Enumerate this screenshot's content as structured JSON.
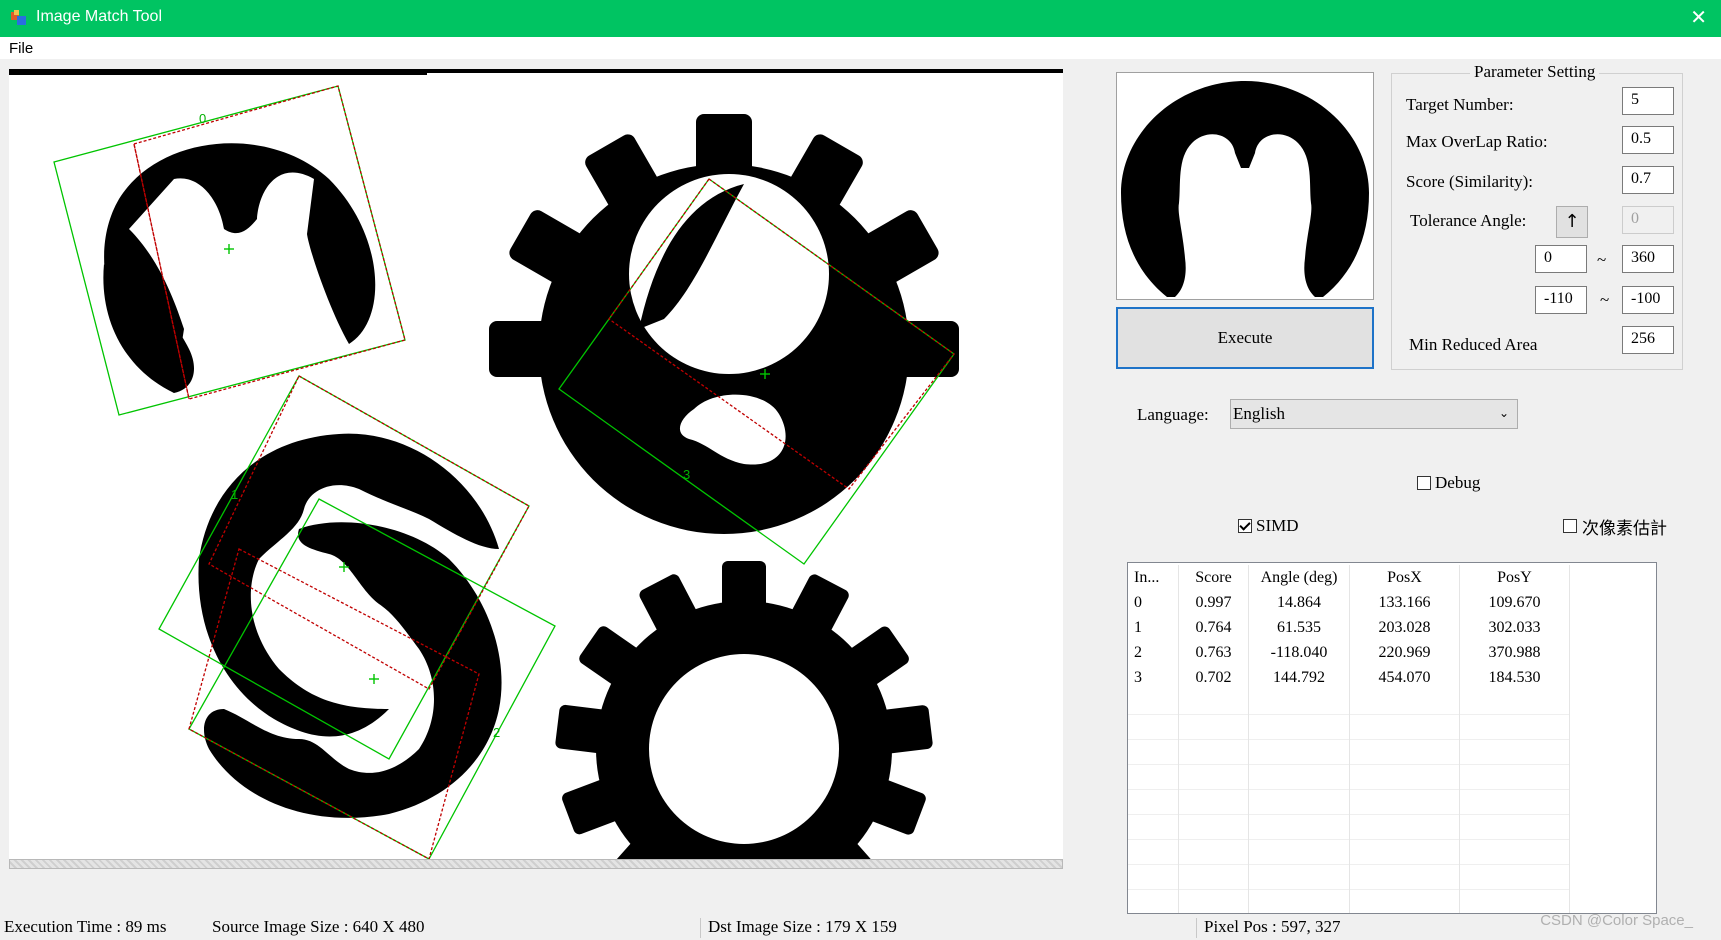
{
  "window": {
    "title": "Image Match Tool",
    "close_glyph": "✕"
  },
  "menu": {
    "file": "File"
  },
  "canvas": {
    "match_labels": [
      "0",
      "1",
      "2",
      "3"
    ],
    "accent_color": "#00c400",
    "dash_color": "#c00000"
  },
  "execute_label": "Execute",
  "params": {
    "legend": "Parameter Setting",
    "target_number": {
      "label": "Target Number:",
      "value": "5"
    },
    "max_overlap": {
      "label": "Max OverLap Ratio:",
      "value": "0.5"
    },
    "score": {
      "label": "Score (Similarity):",
      "value": "0.7"
    },
    "tolerance": {
      "label": "Tolerance Angle:",
      "arrow": "↑",
      "value": "0",
      "range1_min": "0",
      "range1_max": "360",
      "range2_min": "-110",
      "range2_max": "-100",
      "tilde": "~"
    },
    "min_area": {
      "label": "Min Reduced Area",
      "value": "256"
    }
  },
  "language": {
    "label": "Language:",
    "value": "English"
  },
  "options": {
    "debug": {
      "label": "Debug",
      "checked": false
    },
    "simd": {
      "label": "SIMD",
      "checked": true
    },
    "subpixel": {
      "label": "次像素估計",
      "checked": false
    }
  },
  "results": {
    "columns": [
      "In...",
      "Score",
      "Angle (deg)",
      "PosX",
      "PosY"
    ],
    "rows": [
      [
        "0",
        "0.997",
        "14.864",
        "133.166",
        "109.670"
      ],
      [
        "1",
        "0.764",
        "61.535",
        "203.028",
        "302.033"
      ],
      [
        "2",
        "0.763",
        "-118.040",
        "220.969",
        "370.988"
      ],
      [
        "3",
        "0.702",
        "144.792",
        "454.070",
        "184.530"
      ]
    ]
  },
  "status": {
    "exec_time": "Execution Time : 89 ms",
    "src_size": "Source Image Size : 640 X 480",
    "dst_size": "Dst Image Size : 179 X 159",
    "pixel_pos": "Pixel Pos : 597, 327"
  },
  "watermark": "CSDN @Color Space_"
}
